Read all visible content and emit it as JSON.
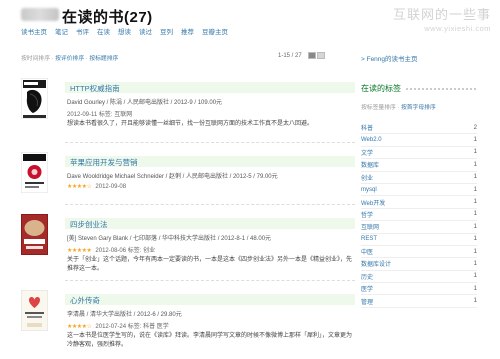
{
  "header": {
    "title": "在读的书(27)",
    "watermark_cn": "互联网的一些事",
    "watermark_url": "www.yixieshi.com"
  },
  "nav": [
    "读书主页",
    "笔记",
    "书评",
    "在读",
    "想读",
    "读过",
    "豆列",
    "推荐",
    "豆瓣主页"
  ],
  "sortbar": {
    "current": "按时间排序",
    "sep": " · ",
    "by_rating": "按评价排序",
    "by_title": "按标题排序"
  },
  "pager": {
    "range": "1-15 / 27"
  },
  "books": [
    {
      "title": "HTTP权威指南",
      "meta": "David Gourley / 陈涓 / 人民邮电出版社 / 2012-9 / 109.00元",
      "date_tags": "2012-09-11  标签: 互联网",
      "desc": "想读本书看很久了，开且能够读懂一丝细节，找一份互联网方面的技术工作真不是太八回避。",
      "stars": ""
    },
    {
      "title": "苹果应用开发与营销",
      "meta": "Dave Wooldridge Michael Schneider / 赵俐 / 人民邮电出版社 / 2012-5 / 79.00元",
      "date_tags": "2012-09-08",
      "desc": "",
      "stars": "★★★★☆"
    },
    {
      "title": "四步创业法",
      "meta": "[美] Steven Gary Blank / 七印部落 / 华中科技大学出版社 / 2012-8-1 / 48.00元",
      "date_tags": "2012-08-06  标签: 创业",
      "desc": "关于「创业」这个话题，今年有两本一定要读的书，一本是这本《四步创业法》另外一本是《精益创业》，先推荐这一本。",
      "stars": "★★★★★"
    },
    {
      "title": "心外传奇",
      "meta": "李清晨 / 清华大学出版社 / 2012-6 / 29.80元",
      "date_tags": "2012-07-24  标签: 科普 医学",
      "desc": "这一本书是位医学生写的，说在《读库》拜读。李清晨同学写文章的时候不像微博上那样「犀利」，文章更为冷静客观，强烈推荐。",
      "stars": "★★★★☆"
    }
  ],
  "sidebar": {
    "home_link": "> Fenng的读书主页",
    "tags_title": "在读的标签",
    "tags_sort_current": "按标签量排序",
    "tags_sort_sep": " · ",
    "tags_sort_alpha": "按首字母排序",
    "tags": [
      {
        "name": "科普",
        "count": "2"
      },
      {
        "name": "Web2.0",
        "count": "1"
      },
      {
        "name": "文学",
        "count": "1"
      },
      {
        "name": "数据库",
        "count": "1"
      },
      {
        "name": "创业",
        "count": "1"
      },
      {
        "name": "mysql",
        "count": "1"
      },
      {
        "name": "Web开发",
        "count": "1"
      },
      {
        "name": "哲学",
        "count": "1"
      },
      {
        "name": "互联网",
        "count": "1"
      },
      {
        "name": "REST",
        "count": "1"
      },
      {
        "name": "中医",
        "count": "1"
      },
      {
        "name": "数据库设计",
        "count": "1"
      },
      {
        "name": "历史",
        "count": "1"
      },
      {
        "name": "医学",
        "count": "1"
      },
      {
        "name": "管理",
        "count": "1"
      }
    ]
  },
  "colors": {
    "link": "#3377aa",
    "title_bg": "#eef9eb",
    "star": "#f6a623",
    "tags_title": "#007722"
  }
}
